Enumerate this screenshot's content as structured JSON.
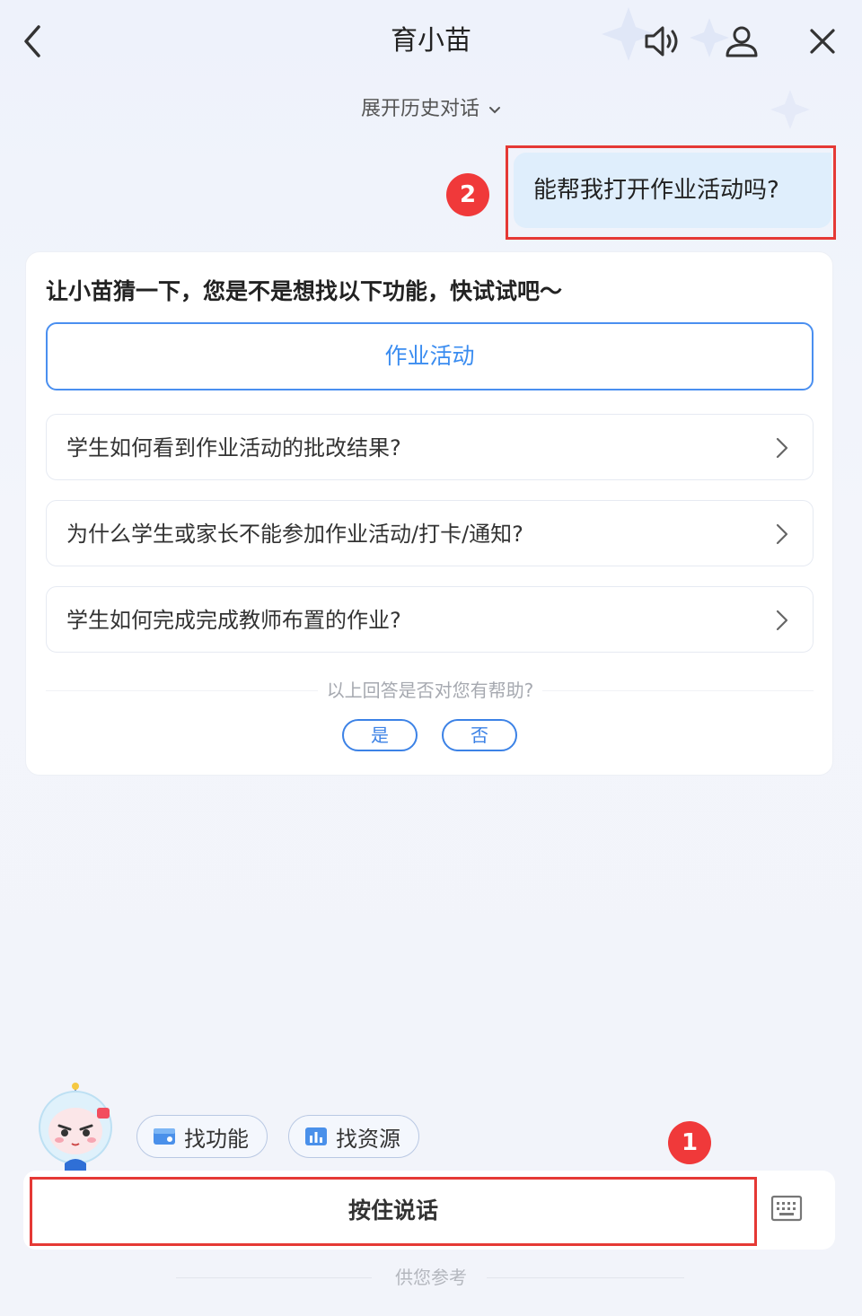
{
  "header": {
    "title": "育小苗",
    "expand_history": "展开历史对话"
  },
  "icons": {
    "back": "chevron-left-icon",
    "speaker": "speaker-icon",
    "profile": "user-icon",
    "close": "close-icon",
    "keyboard": "keyboard-icon"
  },
  "chat": {
    "user_message": "能帮我打开作业活动吗?",
    "bot_card": {
      "title": "让小苗猜一下，您是不是想找以下功能，快试试吧～",
      "primary_option": "作业活动",
      "questions": [
        "学生如何看到作业活动的批改结果?",
        "为什么学生或家长不能参加作业活动/打卡/通知?",
        "学生如何完成完成教师布置的作业?"
      ],
      "helpful_prompt": "以上回答是否对您有帮助?",
      "yes": "是",
      "no": "否"
    }
  },
  "annotations": {
    "badge_1": "1",
    "badge_2": "2"
  },
  "quick_actions": {
    "find_feature": "找功能",
    "find_resource": "找资源"
  },
  "input_bar": {
    "hold_to_talk": "按住说话"
  },
  "footer": {
    "disclaimer": "供您参考"
  },
  "colors": {
    "accent_blue": "#3a8cf0",
    "annotation_red": "#e53935",
    "user_bubble": "#dfeefc"
  }
}
